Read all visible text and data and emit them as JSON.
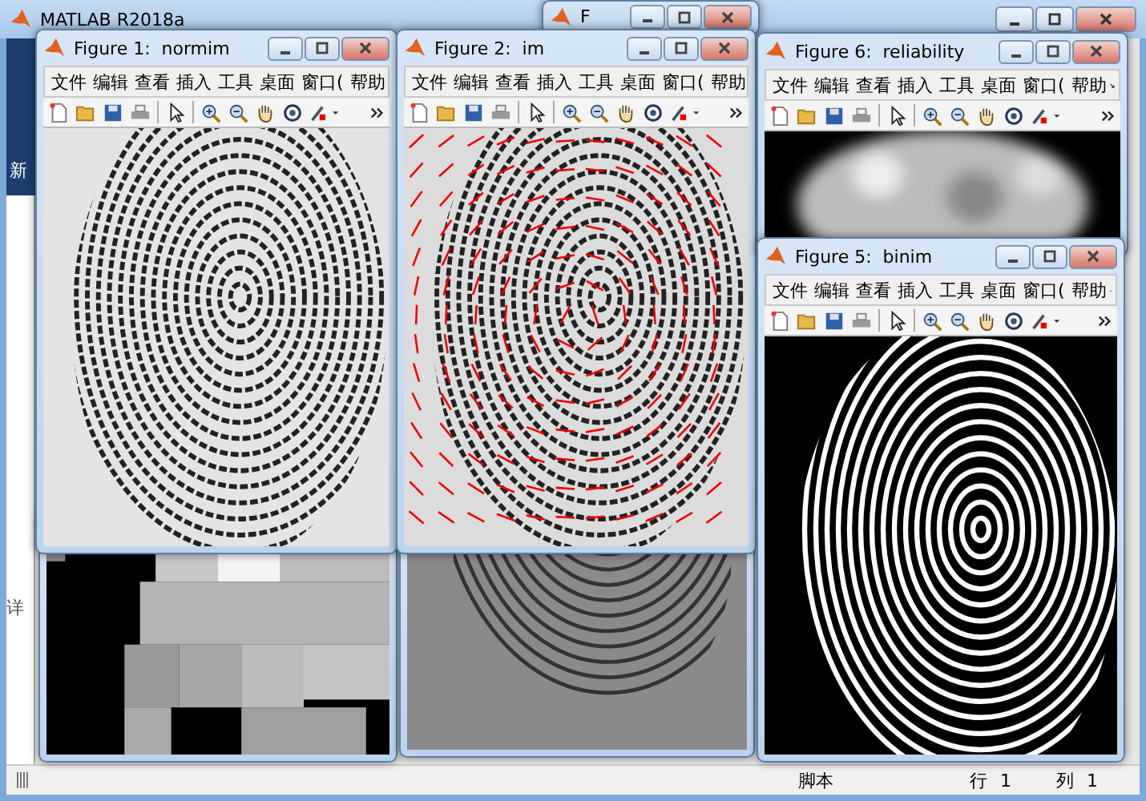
{
  "main_window": {
    "title": "MATLAB R2018a",
    "toolstrip_label": "新",
    "side_label": "详",
    "status_bar": {
      "mode": "脚本",
      "row_label": "行",
      "row": "1",
      "col_label": "列",
      "col": "1"
    }
  },
  "figures": [
    {
      "title": "F",
      "kind": "none"
    },
    {
      "kind": "blocks"
    },
    {
      "kind": "filtered"
    },
    {
      "title": "Figure 1:  normim",
      "kind": "fingerprint",
      "menu": [
        "文件",
        "编辑",
        "查看",
        "插入",
        "工具",
        "桌面",
        "窗口(",
        "帮助"
      ]
    },
    {
      "title": "Figure 2:  im",
      "kind": "orientation",
      "menu": [
        "文件",
        "编辑",
        "查看",
        "插入",
        "工具",
        "桌面",
        "窗口(",
        "帮助"
      ]
    },
    {
      "title": "Figure 6:  reliability",
      "kind": "reliability",
      "menu": [
        "文件",
        "编辑",
        "查看",
        "插入",
        "工具",
        "桌面",
        "窗口(",
        "帮助"
      ]
    },
    {
      "title": "Figure 5:  binim",
      "kind": "binary",
      "menu": [
        "文件",
        "编辑",
        "查看",
        "插入",
        "工具",
        "桌面",
        "窗口(",
        "帮助"
      ]
    }
  ]
}
